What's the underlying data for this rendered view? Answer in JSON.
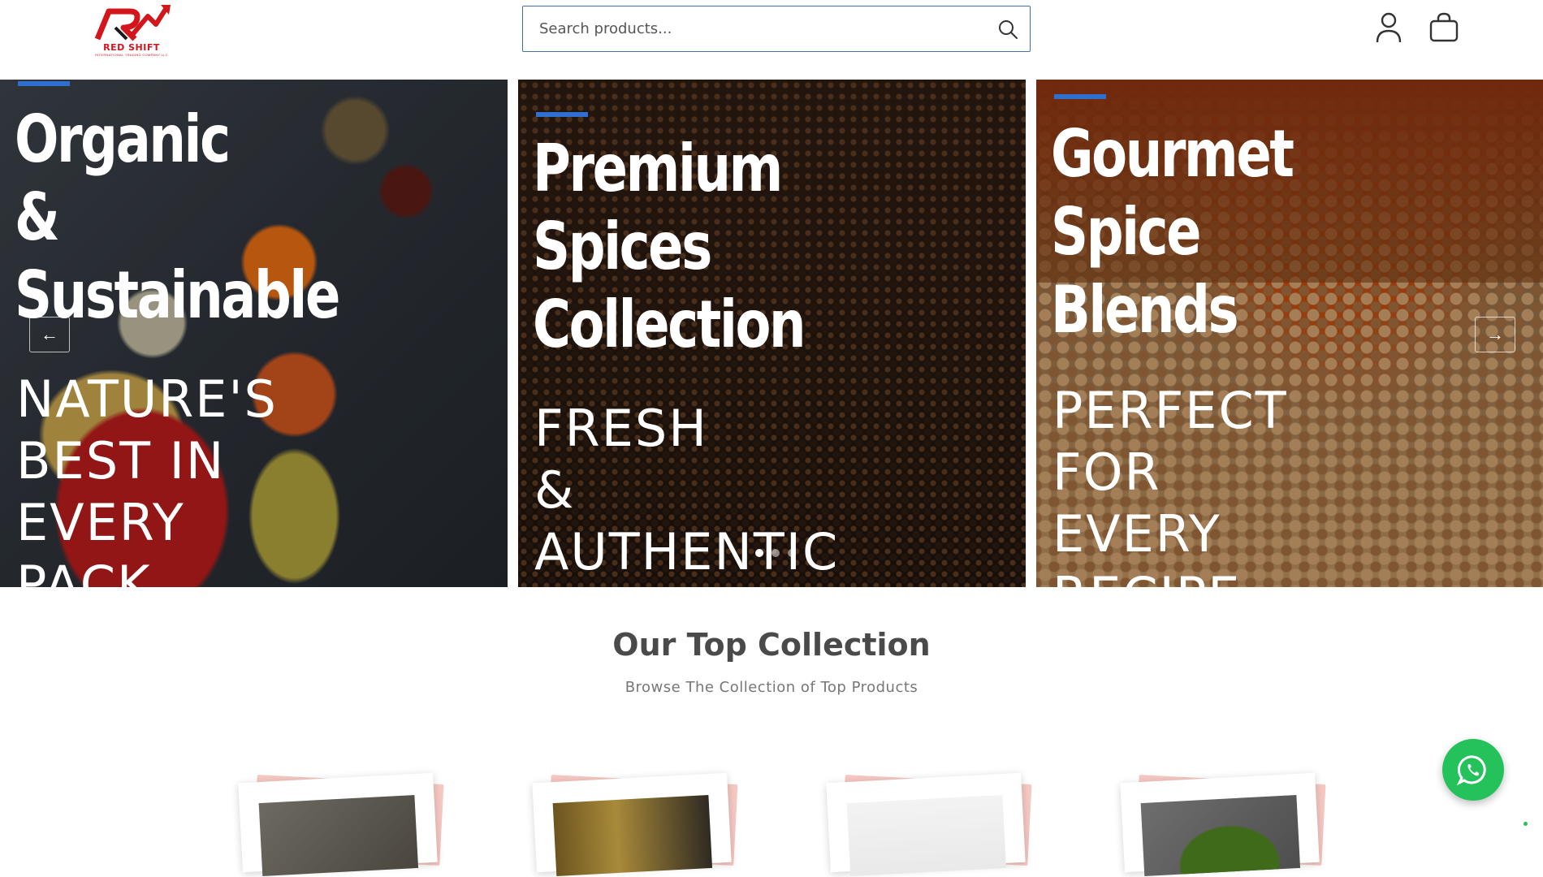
{
  "brand": {
    "name": "RED SHIFT",
    "tagline": "INTERNATIONAL TRADING COMPANY LLC",
    "color": "#d2161c"
  },
  "search": {
    "placeholder": "Search products..."
  },
  "header_icons": [
    "search-icon",
    "user-icon",
    "shopping-bag-icon"
  ],
  "hero": {
    "slides": [
      {
        "title": "Organic\n&\nSustainable",
        "subtitle": "NATURE'S\nBEST IN\nEVERY\nPACK"
      },
      {
        "title": "Premium\nSpices\nCollection",
        "subtitle": "FRESH\n&\nAUTHENTIC"
      },
      {
        "title": "Gourmet\nSpice\nBlends",
        "subtitle": "PERFECT\nFOR\nEVERY\nRECIPE"
      }
    ],
    "prev_icon": "arrow-left-icon",
    "next_icon": "arrow-right-icon",
    "accent_color": "#2f6fd0"
  },
  "collection": {
    "title": "Our Top Collection",
    "subtitle": "Browse The Collection of Top Products"
  },
  "whatsapp": {
    "icon": "whatsapp-icon",
    "color": "#25c25c"
  }
}
